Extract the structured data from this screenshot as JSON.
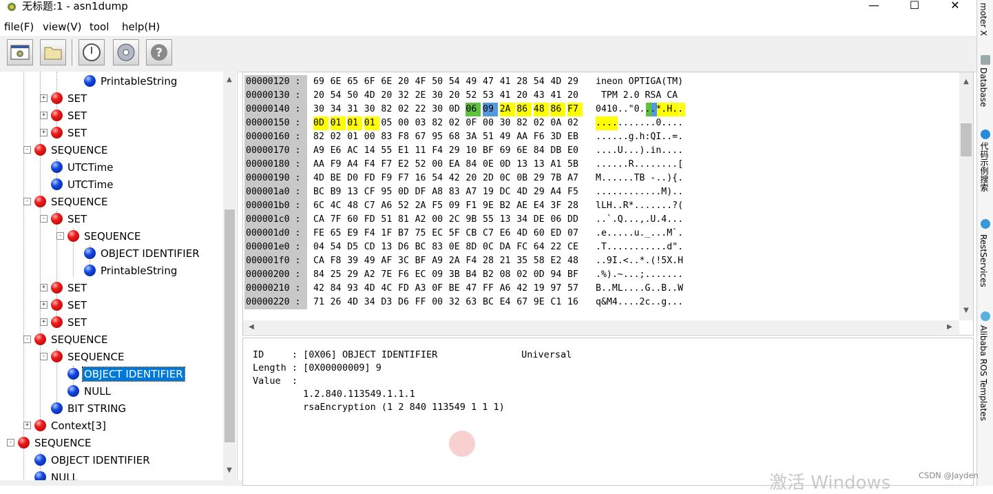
{
  "window": {
    "title": "无标题:1 - asn1dump",
    "minimize": "—",
    "maximize": "☐",
    "close": "✕"
  },
  "menu": [
    "file(F)",
    "view(V)",
    "tool",
    "help(H)"
  ],
  "toolbar": {
    "buttons": [
      "settings-button",
      "open-folder-button",
      "power-button",
      "disk-button",
      "help-button"
    ]
  },
  "tree": [
    {
      "label": "PrintableString",
      "color": "blue",
      "level": 3,
      "exp": ""
    },
    {
      "label": "SET",
      "color": "red",
      "level": 1,
      "exp": "+"
    },
    {
      "label": "SET",
      "color": "red",
      "level": 1,
      "exp": "+"
    },
    {
      "label": "SET",
      "color": "red",
      "level": 1,
      "exp": "+"
    },
    {
      "label": "SEQUENCE",
      "color": "red",
      "level": 0,
      "exp": "-"
    },
    {
      "label": "UTCTime",
      "color": "blue",
      "level": 1,
      "exp": ""
    },
    {
      "label": "UTCTime",
      "color": "blue",
      "level": 1,
      "exp": ""
    },
    {
      "label": "SEQUENCE",
      "color": "red",
      "level": 0,
      "exp": "-"
    },
    {
      "label": "SET",
      "color": "red",
      "level": 1,
      "exp": "-"
    },
    {
      "label": "SEQUENCE",
      "color": "red",
      "level": 2,
      "exp": "-"
    },
    {
      "label": "OBJECT IDENTIFIER",
      "color": "blue",
      "level": 3,
      "exp": ""
    },
    {
      "label": "PrintableString",
      "color": "blue",
      "level": 3,
      "exp": ""
    },
    {
      "label": "SET",
      "color": "red",
      "level": 1,
      "exp": "+"
    },
    {
      "label": "SET",
      "color": "red",
      "level": 1,
      "exp": "+"
    },
    {
      "label": "SET",
      "color": "red",
      "level": 1,
      "exp": "+"
    },
    {
      "label": "SEQUENCE",
      "color": "red",
      "level": 0,
      "exp": "-"
    },
    {
      "label": "SEQUENCE",
      "color": "red",
      "level": 1,
      "exp": "-"
    },
    {
      "label": "OBJECT IDENTIFIER",
      "color": "blue",
      "level": 2,
      "exp": "",
      "selected": true
    },
    {
      "label": "NULL",
      "color": "blue",
      "level": 2,
      "exp": ""
    },
    {
      "label": "BIT STRING",
      "color": "blue",
      "level": 1,
      "exp": ""
    },
    {
      "label": "Context[3]",
      "color": "red",
      "level": 0,
      "exp": "+"
    },
    {
      "label": "SEQUENCE",
      "color": "red",
      "level": -1,
      "exp": "-"
    },
    {
      "label": "OBJECT IDENTIFIER",
      "color": "blue",
      "level": 0,
      "exp": ""
    },
    {
      "label": "NULL",
      "color": "blue",
      "level": 0,
      "exp": ""
    }
  ],
  "hex": [
    {
      "addr": "00000120 :",
      "bytes": [
        "69",
        "6E",
        "65",
        "6F",
        "6E",
        "20",
        "4F",
        "50",
        "54",
        "49",
        "47",
        "41",
        "28",
        "54",
        "4D",
        "29"
      ],
      "ascii": "ineon OPTIGA(TM)"
    },
    {
      "addr": "00000130 :",
      "bytes": [
        "20",
        "54",
        "50",
        "4D",
        "20",
        "32",
        "2E",
        "30",
        "20",
        "52",
        "53",
        "41",
        "20",
        "43",
        "41",
        "20"
      ],
      "ascii": " TPM 2.0 RSA CA "
    },
    {
      "addr": "00000140 :",
      "bytes": [
        "30",
        "34",
        "31",
        "30",
        "82",
        "02",
        "22",
        "30",
        "0D",
        "06",
        "09",
        "2A",
        "86",
        "48",
        "86",
        "F7"
      ],
      "ascii": "0410..\"0...*.H.."
    },
    {
      "addr": "00000150 :",
      "bytes": [
        "0D",
        "01",
        "01",
        "01",
        "05",
        "00",
        "03",
        "82",
        "02",
        "0F",
        "00",
        "30",
        "82",
        "02",
        "0A",
        "02"
      ],
      "ascii": "...........0...."
    },
    {
      "addr": "00000160 :",
      "bytes": [
        "82",
        "02",
        "01",
        "00",
        "83",
        "F8",
        "67",
        "95",
        "68",
        "3A",
        "51",
        "49",
        "AA",
        "F6",
        "3D",
        "EB"
      ],
      "ascii": "......g.h:QI..=."
    },
    {
      "addr": "00000170 :",
      "bytes": [
        "A9",
        "E6",
        "AC",
        "14",
        "55",
        "E1",
        "11",
        "F4",
        "29",
        "10",
        "BF",
        "69",
        "6E",
        "84",
        "DB",
        "E0"
      ],
      "ascii": "....U...).in...."
    },
    {
      "addr": "00000180 :",
      "bytes": [
        "AA",
        "F9",
        "A4",
        "F4",
        "F7",
        "E2",
        "52",
        "00",
        "EA",
        "84",
        "0E",
        "0D",
        "13",
        "13",
        "A1",
        "5B"
      ],
      "ascii": "......R........["
    },
    {
      "addr": "00000190 :",
      "bytes": [
        "4D",
        "BE",
        "D0",
        "FD",
        "F9",
        "F7",
        "16",
        "54",
        "42",
        "20",
        "2D",
        "0C",
        "0B",
        "29",
        "7B",
        "A7"
      ],
      "ascii": "M......TB -..){."
    },
    {
      "addr": "000001a0 :",
      "bytes": [
        "BC",
        "B9",
        "13",
        "CF",
        "95",
        "0D",
        "DF",
        "A8",
        "83",
        "A7",
        "19",
        "DC",
        "4D",
        "29",
        "A4",
        "F5"
      ],
      "ascii": "............M).."
    },
    {
      "addr": "000001b0 :",
      "bytes": [
        "6C",
        "4C",
        "48",
        "C7",
        "A6",
        "52",
        "2A",
        "F5",
        "09",
        "F1",
        "9E",
        "B2",
        "AE",
        "E4",
        "3F",
        "28"
      ],
      "ascii": "lLH..R*.......?("
    },
    {
      "addr": "000001c0 :",
      "bytes": [
        "CA",
        "7F",
        "60",
        "FD",
        "51",
        "81",
        "A2",
        "00",
        "2C",
        "9B",
        "55",
        "13",
        "34",
        "DE",
        "06",
        "DD"
      ],
      "ascii": "..`.Q...,.U.4..."
    },
    {
      "addr": "000001d0 :",
      "bytes": [
        "FE",
        "65",
        "E9",
        "F4",
        "1F",
        "B7",
        "75",
        "EC",
        "5F",
        "CB",
        "C7",
        "E6",
        "4D",
        "60",
        "ED",
        "07"
      ],
      "ascii": ".e.....u._...M`."
    },
    {
      "addr": "000001e0 :",
      "bytes": [
        "04",
        "54",
        "D5",
        "CD",
        "13",
        "D6",
        "BC",
        "83",
        "0E",
        "8D",
        "0C",
        "DA",
        "FC",
        "64",
        "22",
        "CE"
      ],
      "ascii": ".T...........d\"."
    },
    {
      "addr": "000001f0 :",
      "bytes": [
        "CA",
        "F8",
        "39",
        "49",
        "AF",
        "3C",
        "BF",
        "A9",
        "2A",
        "F4",
        "28",
        "21",
        "35",
        "58",
        "E2",
        "48"
      ],
      "ascii": "..9I.<..*.(!5X.H"
    },
    {
      "addr": "00000200 :",
      "bytes": [
        "84",
        "25",
        "29",
        "A2",
        "7E",
        "F6",
        "EC",
        "09",
        "3B",
        "B4",
        "B2",
        "08",
        "02",
        "0D",
        "94",
        "BF"
      ],
      "ascii": ".%).~...;......."
    },
    {
      "addr": "00000210 :",
      "bytes": [
        "42",
        "84",
        "93",
        "4D",
        "4C",
        "FD",
        "A3",
        "0F",
        "BE",
        "47",
        "FF",
        "A6",
        "42",
        "19",
        "97",
        "57"
      ],
      "ascii": "B..ML....G..B..W"
    },
    {
      "addr": "00000220 :",
      "bytes": [
        "71",
        "26",
        "4D",
        "34",
        "D3",
        "D6",
        "FF",
        "00",
        "32",
        "63",
        "BC",
        "E4",
        "67",
        "9E",
        "C1",
        "16"
      ],
      "ascii": "q&M4....2c..g..."
    }
  ],
  "highlights": {
    "green": {
      "row": 2,
      "col": 9
    },
    "blue": {
      "row": 2,
      "col": 10
    },
    "yellow": [
      [
        2,
        11
      ],
      [
        2,
        12
      ],
      [
        2,
        13
      ],
      [
        2,
        14
      ],
      [
        2,
        15
      ],
      [
        3,
        0
      ],
      [
        3,
        1
      ],
      [
        3,
        2
      ],
      [
        3,
        3
      ]
    ],
    "colors": {
      "green": "#60c040",
      "blue": "#5599dd",
      "yellow": "#ffff00",
      "selection": "#0078d7"
    }
  },
  "detail": {
    "id_line": "ID     : [0X06] OBJECT IDENTIFIER               Universal",
    "length_line": "Length : [0X00000009] 9",
    "value_line": "Value  :",
    "oid_line": "         1.2.840.113549.1.1.1",
    "name_line": "         rsaEncryption (1 2 840 113549 1 1 1)"
  },
  "side_tabs": [
    "moter X",
    "Database",
    "代码示例搜索",
    "RestServices",
    "Alibaba ROS Templates"
  ],
  "watermark": "激活 Windows",
  "csdn": "CSDN @Jayden"
}
